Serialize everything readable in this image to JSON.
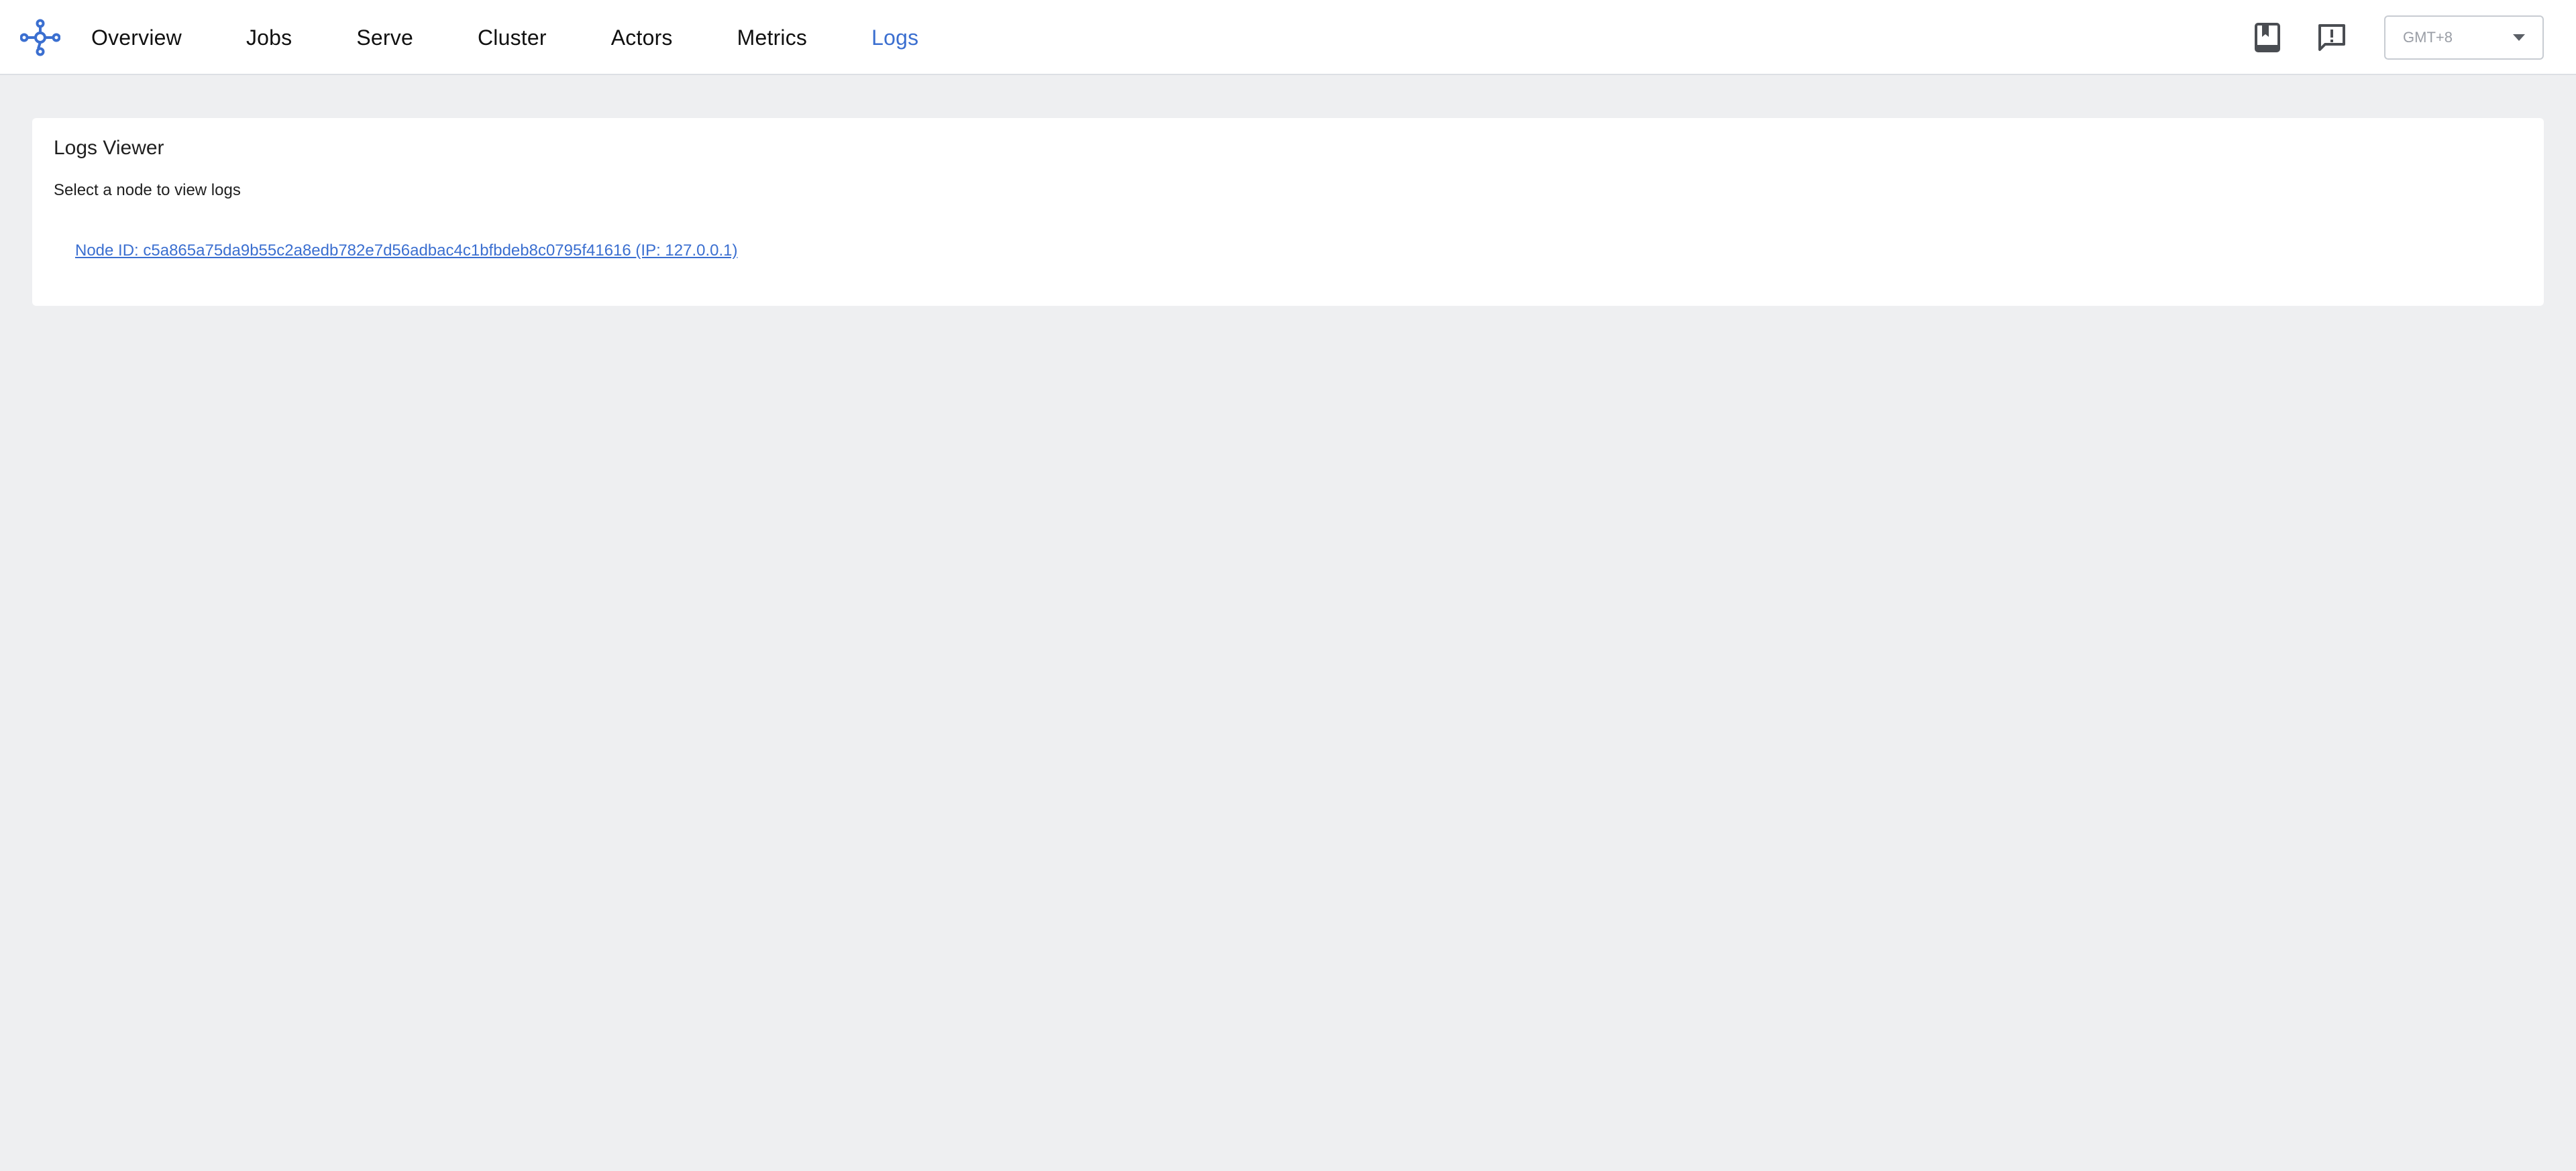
{
  "nav": {
    "items": [
      {
        "label": "Overview",
        "active": false
      },
      {
        "label": "Jobs",
        "active": false
      },
      {
        "label": "Serve",
        "active": false
      },
      {
        "label": "Cluster",
        "active": false
      },
      {
        "label": "Actors",
        "active": false
      },
      {
        "label": "Metrics",
        "active": false
      },
      {
        "label": "Logs",
        "active": true
      }
    ]
  },
  "toolbar": {
    "docs_icon": "book-icon",
    "feedback_icon": "feedback-icon",
    "timezone": {
      "selected": "GMT+8"
    }
  },
  "logs_viewer": {
    "title": "Logs Viewer",
    "subtitle": "Select a node to view logs",
    "nodes": [
      {
        "label": "Node ID: c5a865a75da9b55c2a8edb782e7d56adbac4c1bfbdeb8c0795f41616 (IP: 127.0.0.1)"
      }
    ]
  },
  "colors": {
    "accent": "#3b6fd0",
    "background": "#eeeff1",
    "surface": "#ffffff"
  }
}
